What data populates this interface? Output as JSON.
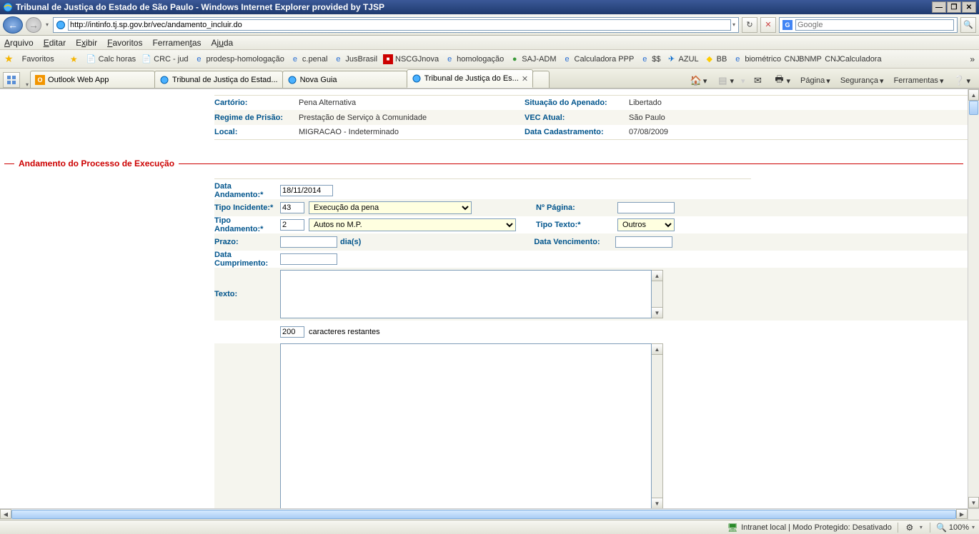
{
  "window": {
    "title": "Tribunal de Justiça do Estado de São Paulo - Windows Internet Explorer provided by TJSP"
  },
  "address": {
    "url": "http://intinfo.tj.sp.gov.br/vec/andamento_incluir.do"
  },
  "search": {
    "placeholder": "Google"
  },
  "menu": {
    "arquivo": "Arquivo",
    "editar": "Editar",
    "exibir": "Exibir",
    "favoritos": "Favoritos",
    "ferramentas": "Ferramentas",
    "ajuda": "Ajuda"
  },
  "favbar": {
    "label": "Favoritos",
    "items": [
      "Calc horas",
      "CRC - jud",
      "prodesp-homologação",
      "c.penal",
      "JusBrasil",
      "NSCGJnova",
      "homologação",
      "SAJ-ADM",
      "Calculadora PPP",
      "$$",
      "AZUL",
      "BB",
      "biométrico",
      "BNMP",
      "Calculadora"
    ]
  },
  "tabs": [
    {
      "text": "Outlook Web App"
    },
    {
      "text": "Tribunal de Justiça do Estad..."
    },
    {
      "text": "Nova Guia"
    },
    {
      "text": "Tribunal de Justiça do Es..."
    }
  ],
  "tabtools": {
    "pagina": "Página",
    "seguranca": "Segurança",
    "ferramentas": "Ferramentas"
  },
  "info": {
    "cartorio_lbl": "Cartório:",
    "cartorio_val": "Pena Alternativa",
    "sit_lbl": "Situação do Apenado:",
    "sit_val": "Libertado",
    "regime_lbl": "Regime de Prisão:",
    "regime_val": "Prestação de Serviço à Comunidade",
    "vec_lbl": "VEC Atual:",
    "vec_val": "São Paulo",
    "local_lbl": "Local:",
    "local_val": "MIGRACAO - Indeterminado",
    "datacad_lbl": "Data Cadastramento:",
    "datacad_val": "07/08/2009"
  },
  "section": {
    "title": "Andamento do Processo de Execução"
  },
  "form": {
    "data_and_lbl": "Data Andamento:*",
    "data_and_val": "18/11/2014",
    "tipo_inc_lbl": "Tipo Incidente:*",
    "tipo_inc_code": "43",
    "tipo_inc_sel": "Execução da pena",
    "npag_lbl": "Nº Página:",
    "npag_val": "",
    "tipo_and_lbl": "Tipo Andamento:*",
    "tipo_and_code": "2",
    "tipo_and_sel": "Autos no M.P.",
    "tipo_texto_lbl": "Tipo Texto:*",
    "tipo_texto_sel": "Outros",
    "prazo_lbl": "Prazo:",
    "prazo_val": "",
    "dias_txt": "dia(s)",
    "datavenc_lbl": "Data Vencimento:",
    "datavenc_val": "",
    "datacump_lbl": "Data Cumprimento:",
    "datacump_val": "",
    "texto_lbl": "Texto:",
    "texto_val": "",
    "counter_val": "200",
    "counter_txt": "caracteres restantes",
    "big_val": ""
  },
  "status": {
    "zone": "Intranet local | Modo Protegido: Desativado",
    "zoom": "100%"
  }
}
